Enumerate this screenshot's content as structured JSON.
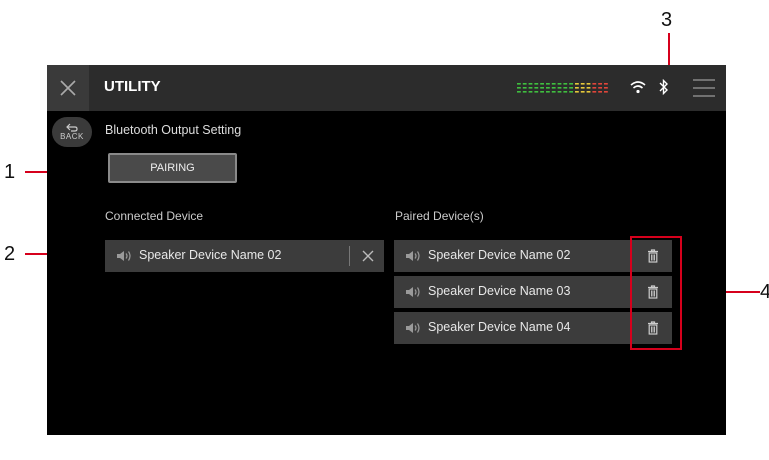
{
  "callouts": {
    "c1": "1",
    "c2": "2",
    "c3": "3",
    "c4": "4"
  },
  "app": {
    "title": "UTILITY",
    "back_label": "BACK",
    "section_title": "Bluetooth Output Setting",
    "pairing_label": "PAIRING"
  },
  "connected": {
    "heading": "Connected Device",
    "device": "Speaker Device Name 02"
  },
  "paired": {
    "heading": "Paired Device(s)",
    "devices": [
      "Speaker Device Name 02",
      "Speaker Device Name 03",
      "Speaker Device Name 04"
    ]
  },
  "icons": {
    "close": "close-icon",
    "menu": "hamburger-icon",
    "wifi": "wifi-icon",
    "bluetooth": "bluetooth-icon",
    "back": "back-arrow-icon",
    "speaker": "speaker-icon",
    "trash": "trash-icon",
    "level": "level-meter"
  },
  "colors": {
    "screen_bg": "#000000",
    "topbar_bg": "#2c2c2c",
    "row_bg": "#3c3c3c",
    "callout": "#d6001c",
    "meter_green": "#3fbf3f",
    "meter_yellow": "#e6c83a",
    "meter_red": "#e0453a"
  }
}
